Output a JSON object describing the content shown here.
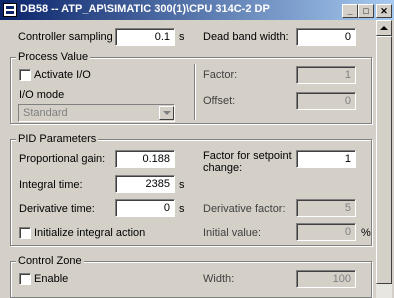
{
  "window": {
    "title": "DB58 -- ATP_AP\\SIMATIC 300(1)\\CPU 314C-2 DP",
    "minimize_glyph": "_",
    "maximize_glyph": "□",
    "close_glyph": "✕"
  },
  "top": {
    "sampling_time_label": "Controller sampling time:",
    "sampling_time_value": "0.1",
    "sampling_time_unit": "s",
    "dead_band_label": "Dead band width:",
    "dead_band_value": "0"
  },
  "process_value": {
    "title": "Process Value",
    "activate_io_label": "Activate I/O",
    "io_mode_label": "I/O mode",
    "io_mode_value": "Standard",
    "factor_label": "Factor:",
    "factor_value": "1",
    "offset_label": "Offset:",
    "offset_value": "0"
  },
  "pid": {
    "title": "PID Parameters",
    "prop_gain_label": "Proportional gain:",
    "prop_gain_value": "0.188",
    "integral_time_label": "Integral time:",
    "integral_time_value": "2385",
    "integral_time_unit": "s",
    "derivative_time_label": "Derivative time:",
    "derivative_time_value": "0",
    "derivative_time_unit": "s",
    "init_integral_label": "Initialize integral action",
    "setpoint_factor_label_1": "Factor for setpoint",
    "setpoint_factor_label_2": "change:",
    "setpoint_factor_value": "1",
    "derivative_factor_label": "Derivative factor:",
    "derivative_factor_value": "5",
    "initial_value_label": "Initial value:",
    "initial_value_value": "0",
    "initial_value_unit": "%"
  },
  "control_zone": {
    "title": "Control Zone",
    "enable_label": "Enable",
    "width_label": "Width:",
    "width_value": "100"
  }
}
